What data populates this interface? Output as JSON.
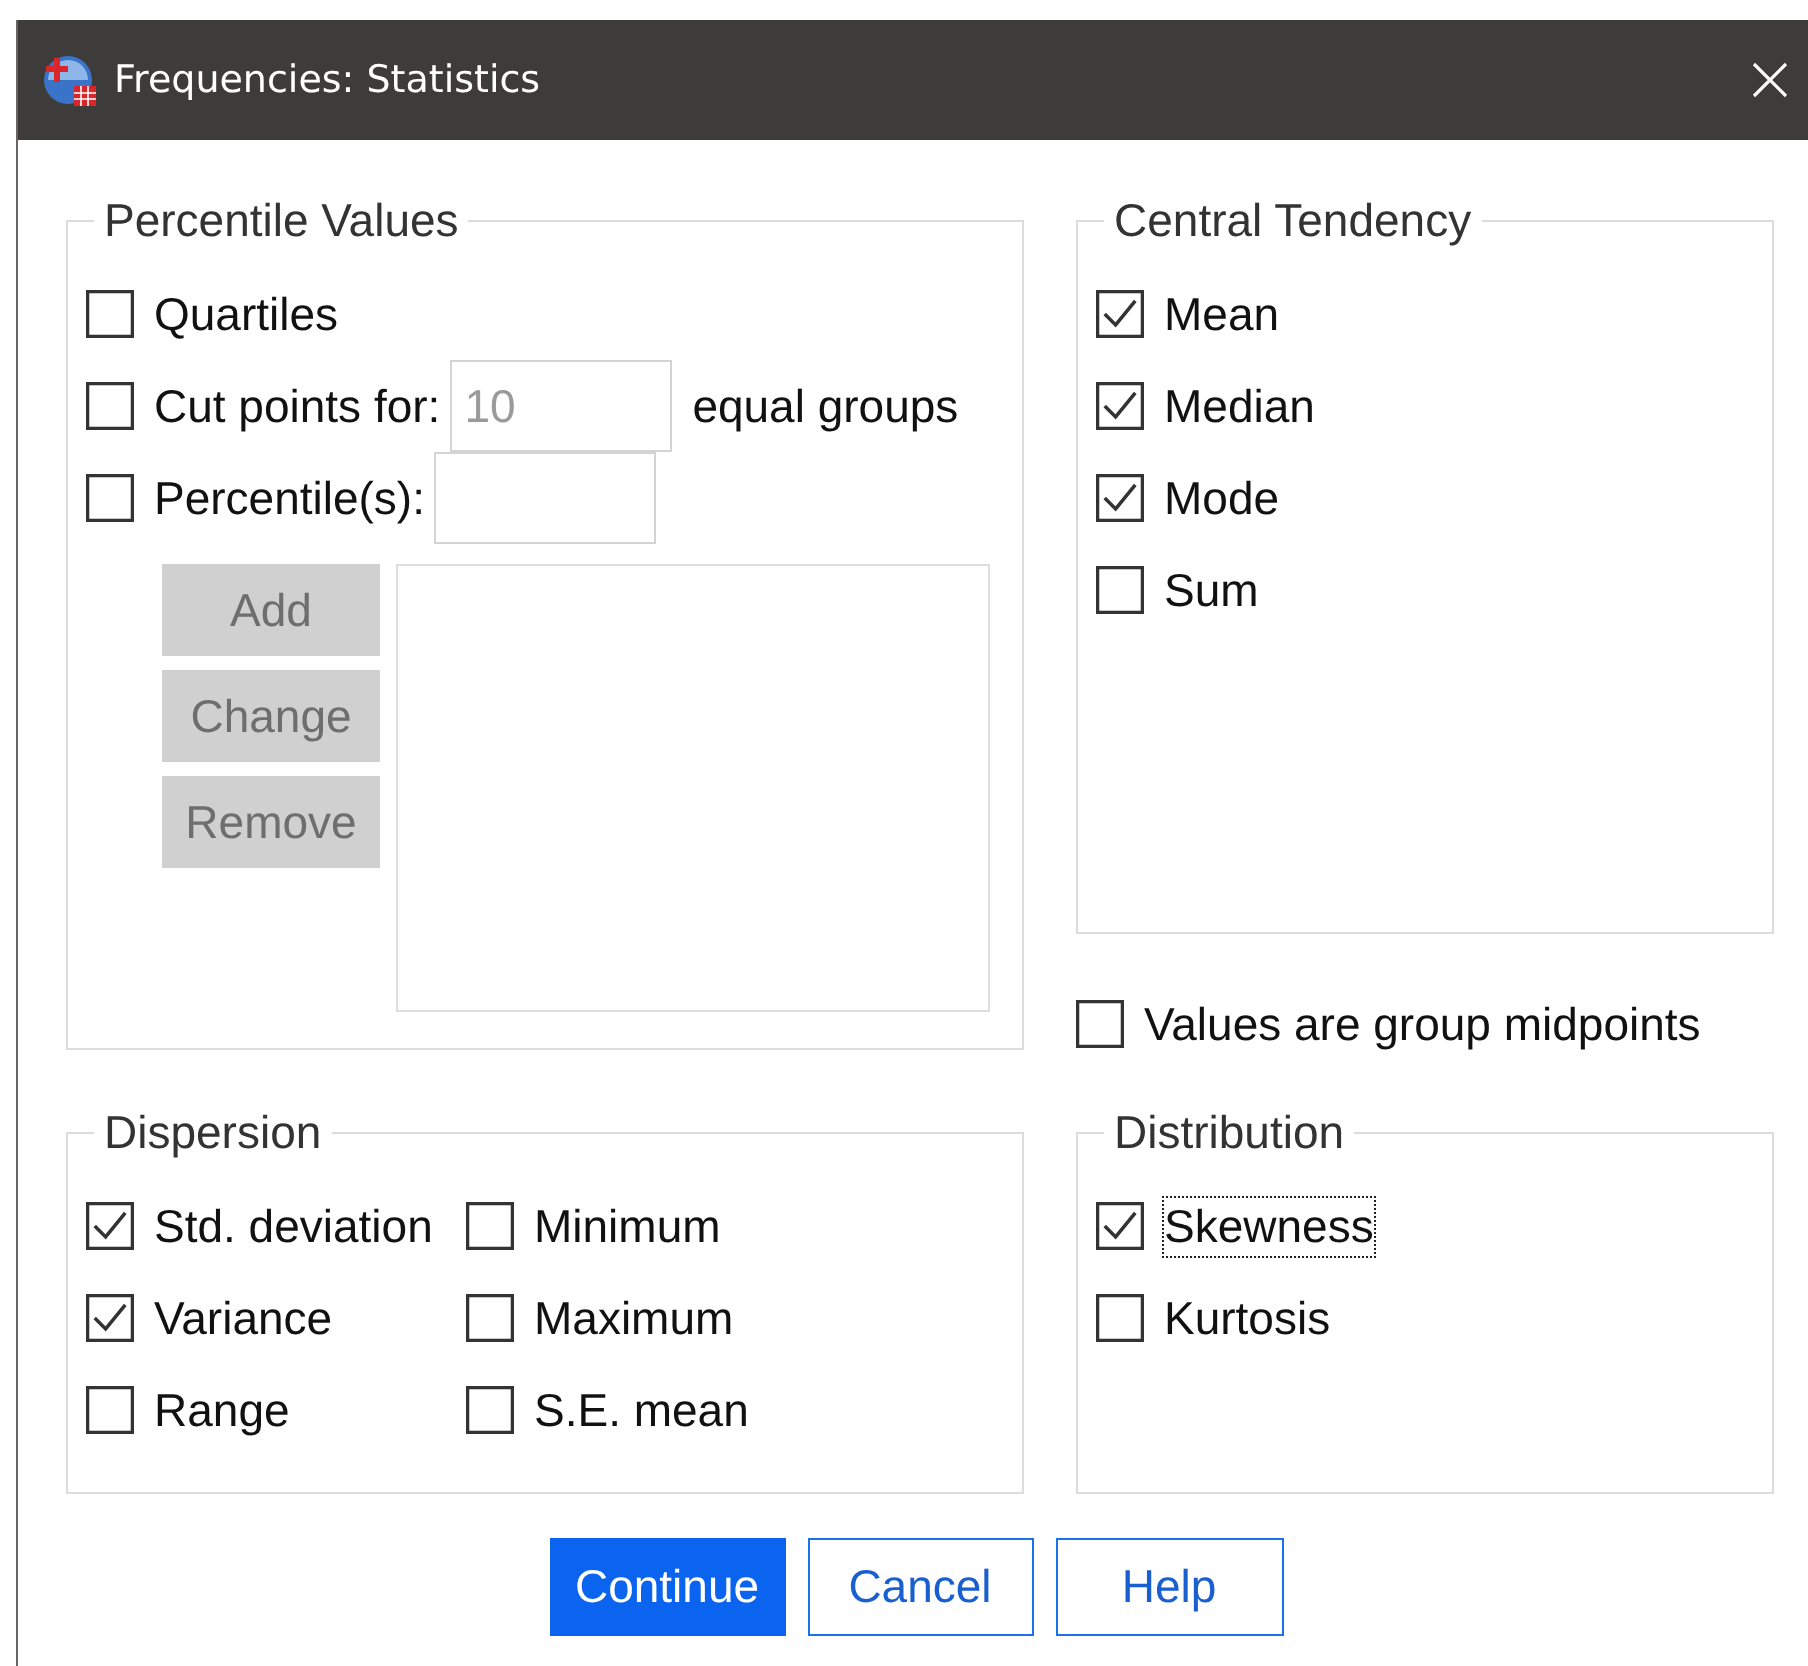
{
  "window": {
    "title": "Frequencies: Statistics"
  },
  "percentile_values": {
    "title": "Percentile Values",
    "options": [
      {
        "kind": "plain",
        "label": "Quartiles",
        "checked": false
      },
      {
        "kind": "field",
        "label": "Cut points for:",
        "checked": false,
        "field": {
          "value": "10",
          "disabled": true
        },
        "suffix": "equal groups"
      },
      {
        "kind": "field",
        "label": "Percentile(s):",
        "checked": false
      }
    ],
    "buttons": [
      {
        "label": "Add",
        "disabled": true
      },
      {
        "label": "Change",
        "disabled": true
      },
      {
        "label": "Remove",
        "disabled": true
      }
    ]
  },
  "central_tendency": {
    "title": "Central Tendency",
    "options": [
      {
        "label": "Mean",
        "checked": true
      },
      {
        "label": "Median",
        "checked": true
      },
      {
        "label": "Mode",
        "checked": true
      },
      {
        "label": "Sum",
        "checked": false
      }
    ]
  },
  "group_midpoints": {
    "label": "Values are group midpoints",
    "checked": false
  },
  "dispersion": {
    "title": "Dispersion",
    "options": [
      {
        "label": "Std. deviation",
        "checked": true
      },
      {
        "label": "Minimum",
        "checked": false
      },
      {
        "label": "Variance",
        "checked": true
      },
      {
        "label": "Maximum",
        "checked": false
      },
      {
        "label": "Range",
        "checked": false
      },
      {
        "label": "S.E. mean",
        "checked": false
      }
    ]
  },
  "distribution": {
    "title": "Distribution",
    "options": [
      {
        "label": "Skewness",
        "checked": true,
        "focused": true
      },
      {
        "label": "Kurtosis",
        "checked": false,
        "focused": false
      }
    ]
  },
  "buttons": [
    {
      "label": "Continue",
      "default": true
    },
    {
      "label": "Cancel",
      "default": false
    },
    {
      "label": "Help",
      "default": false
    }
  ]
}
